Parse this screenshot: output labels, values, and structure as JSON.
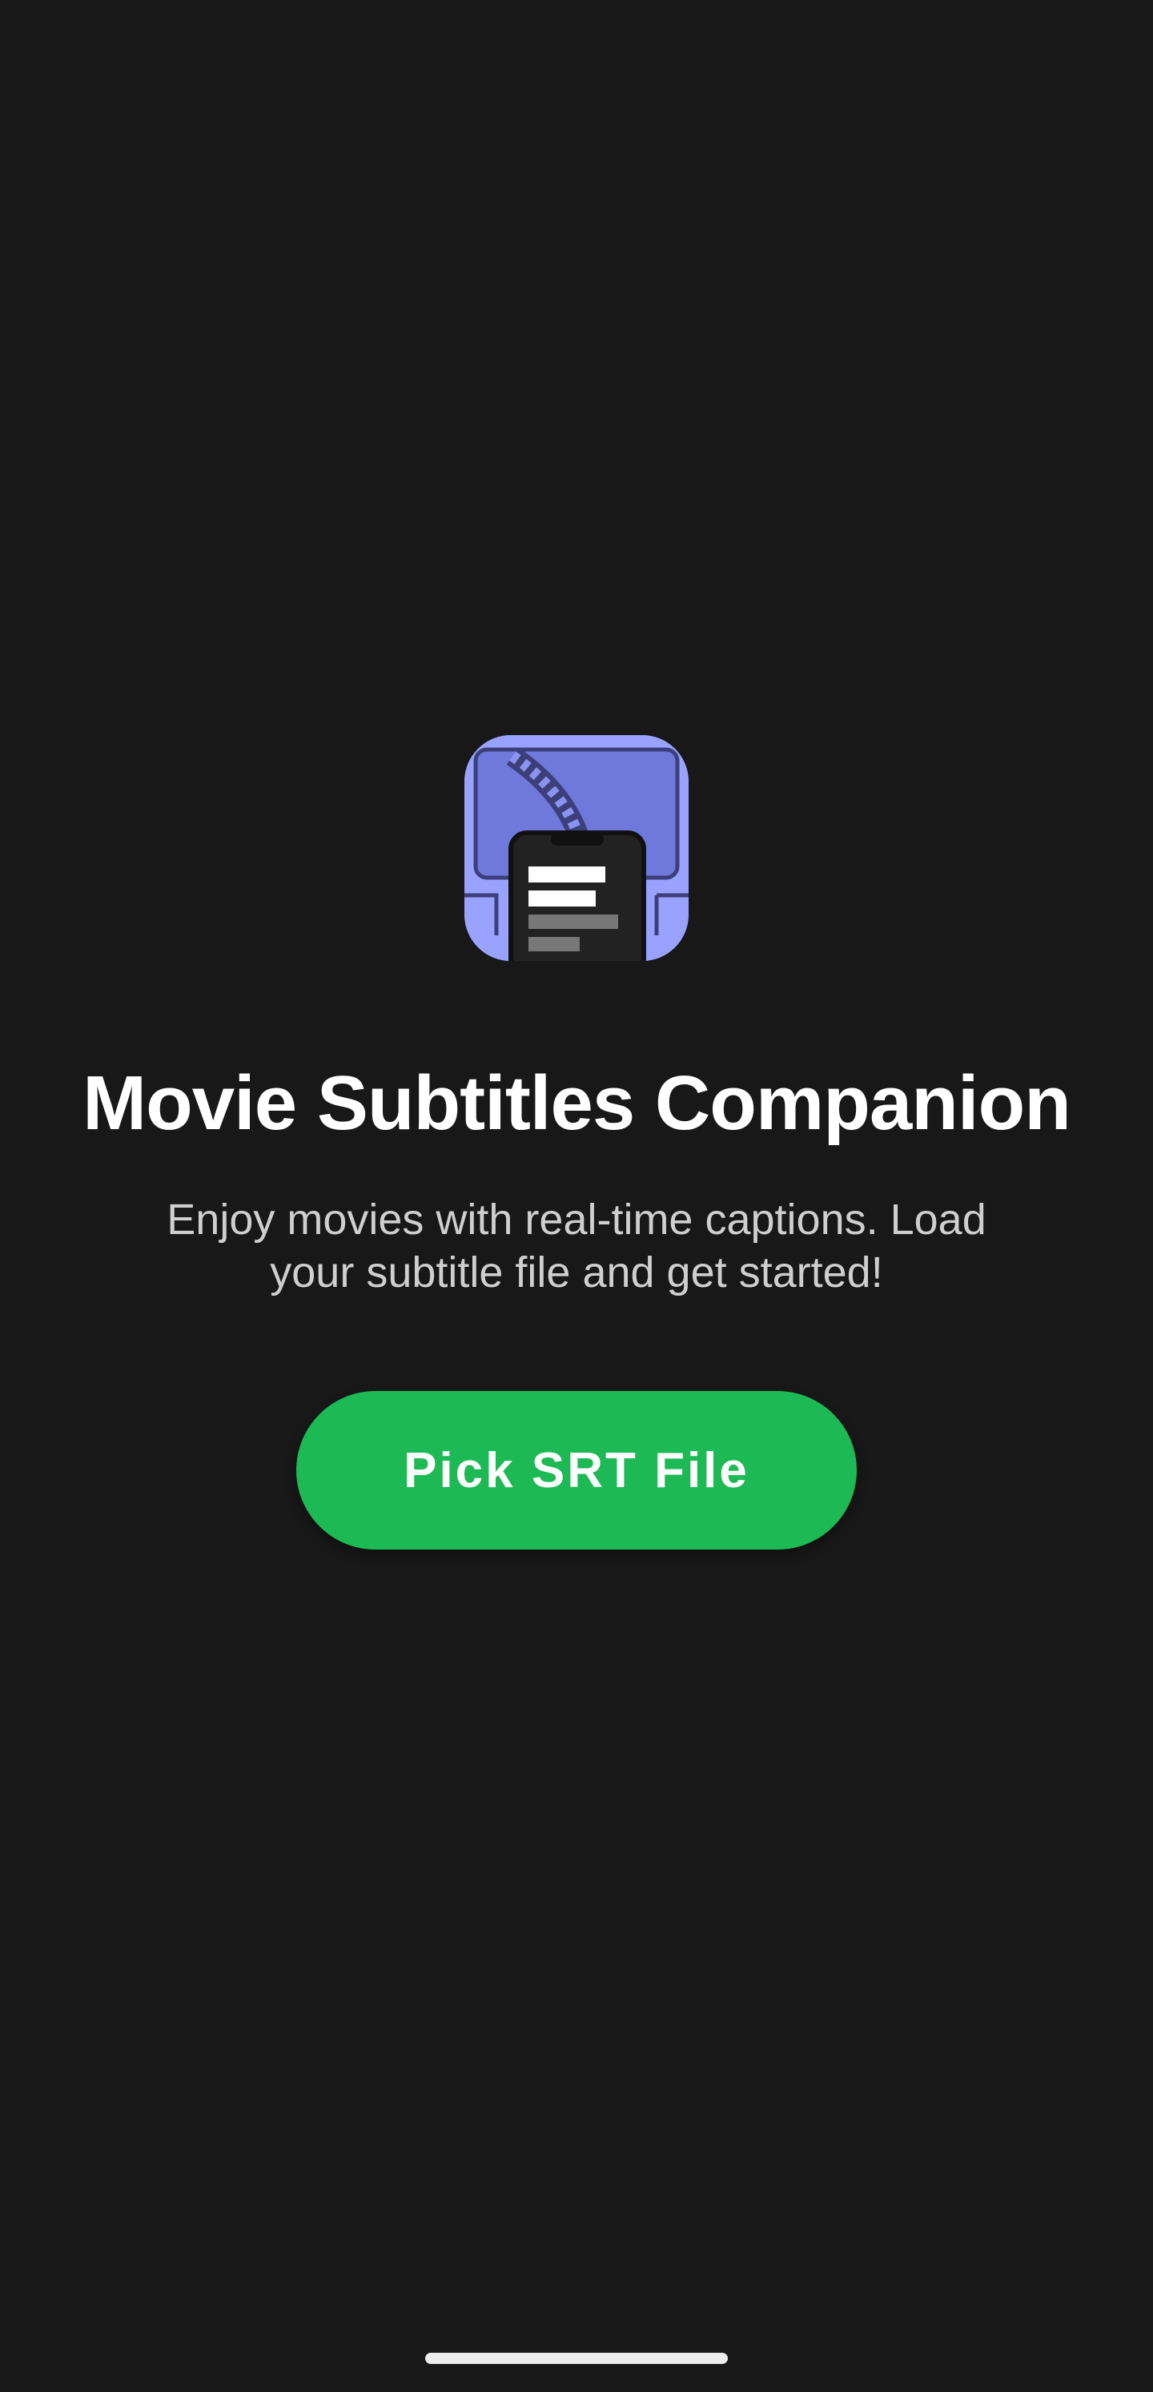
{
  "app": {
    "icon": "movie-subtitles-app-icon",
    "title": "Movie Subtitles Companion",
    "description": "Enjoy movies with real-time captions. Load your subtitle file and get started!"
  },
  "actions": {
    "pick_file_label": "Pick SRT File"
  },
  "colors": {
    "background": "#181818",
    "accent": "#1db954",
    "icon_background": "#99a3ff"
  },
  "system": {
    "home_indicator": "gesture-bar"
  }
}
